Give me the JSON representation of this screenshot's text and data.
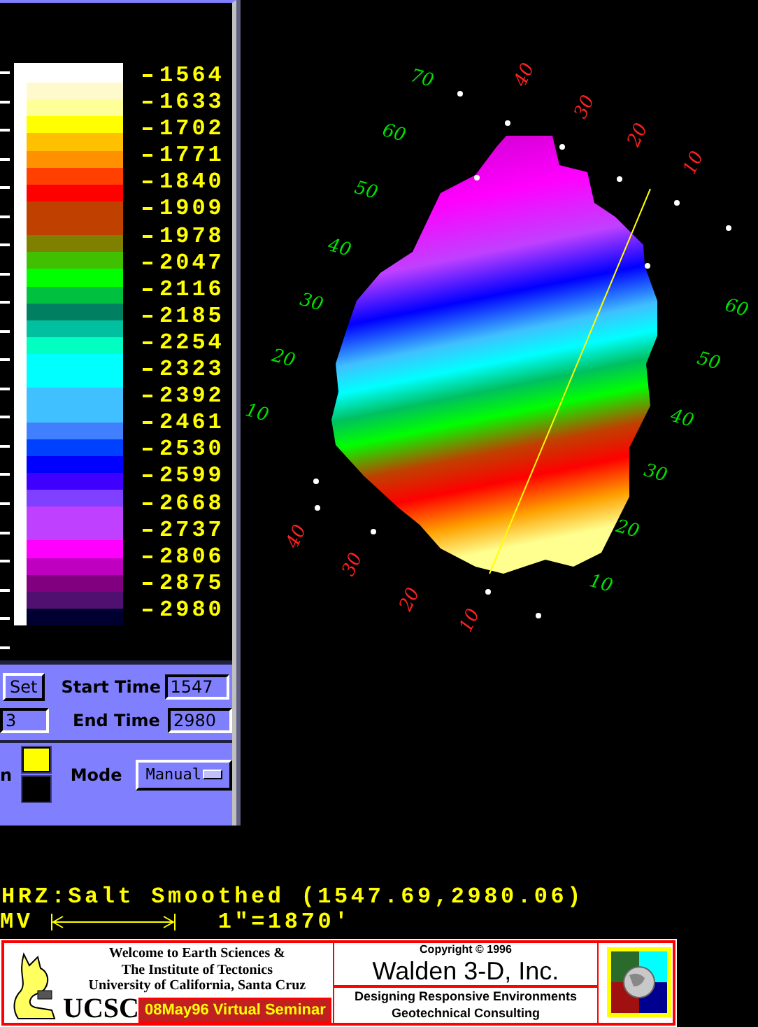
{
  "legend": {
    "bands": [
      {
        "color": "#fffacd"
      },
      {
        "color": "#ffff99"
      },
      {
        "color": "#ffff00"
      },
      {
        "color": "#ffc000"
      },
      {
        "color": "#ff9000"
      },
      {
        "color": "#ff4000"
      },
      {
        "color": "#ff0000"
      },
      {
        "color": "#c04000"
      },
      {
        "color": "#c04000"
      },
      {
        "color": "#808000"
      },
      {
        "color": "#40c000"
      },
      {
        "color": "#00ff00"
      },
      {
        "color": "#00c040"
      },
      {
        "color": "#008060"
      },
      {
        "color": "#00c0a0"
      },
      {
        "color": "#00ffc0"
      },
      {
        "color": "#00ffff"
      },
      {
        "color": "#00ffff"
      },
      {
        "color": "#40c0ff"
      },
      {
        "color": "#40c0ff"
      },
      {
        "color": "#4080ff"
      },
      {
        "color": "#0040ff"
      },
      {
        "color": "#0000ff"
      },
      {
        "color": "#4000ff"
      },
      {
        "color": "#8040ff"
      },
      {
        "color": "#c040ff"
      },
      {
        "color": "#c040ff"
      },
      {
        "color": "#ff00ff"
      },
      {
        "color": "#c000c0"
      },
      {
        "color": "#800080"
      },
      {
        "color": "#501070"
      },
      {
        "color": "#000030"
      }
    ],
    "labels": [
      "1564",
      "1633",
      "1702",
      "1771",
      "1840",
      "1909",
      "1978",
      "2047",
      "2116",
      "2185",
      "2254",
      "2323",
      "2392",
      "2461",
      "2530",
      "2599",
      "2668",
      "2737",
      "2806",
      "2875",
      "2980"
    ]
  },
  "controls": {
    "set_button": "Set",
    "start_time": {
      "label": "Start Time",
      "value": "1547"
    },
    "cut_field_value": "3",
    "end_time": {
      "label": "End Time",
      "value": "2980"
    },
    "cut_label": "n",
    "swatches": [
      {
        "color": "#ffff00"
      },
      {
        "color": "#000000"
      }
    ],
    "mode": {
      "label": "Mode",
      "value": "Manual"
    }
  },
  "map": {
    "grid_labels": [
      {
        "text": "70",
        "kind": "green"
      },
      {
        "text": "60",
        "kind": "green"
      },
      {
        "text": "50",
        "kind": "green"
      },
      {
        "text": "40",
        "kind": "green"
      },
      {
        "text": "30",
        "kind": "green"
      },
      {
        "text": "20",
        "kind": "green"
      },
      {
        "text": "10",
        "kind": "green"
      },
      {
        "text": "40",
        "kind": "red"
      },
      {
        "text": "30",
        "kind": "red"
      },
      {
        "text": "20",
        "kind": "red"
      },
      {
        "text": "10",
        "kind": "red"
      },
      {
        "text": "60",
        "kind": "green"
      },
      {
        "text": "50",
        "kind": "green"
      },
      {
        "text": "40",
        "kind": "green"
      },
      {
        "text": "30",
        "kind": "green"
      },
      {
        "text": "20",
        "kind": "green"
      },
      {
        "text": "10",
        "kind": "green"
      },
      {
        "text": "40",
        "kind": "red"
      },
      {
        "text": "30",
        "kind": "red"
      },
      {
        "text": "20",
        "kind": "red"
      },
      {
        "text": "10",
        "kind": "red"
      }
    ]
  },
  "caption": "HRZ:Salt Smoothed (1547.69,2980.06)",
  "scale": {
    "label": "MV",
    "text": "1\"=1870'"
  },
  "banner": {
    "welcome_lines": [
      "Welcome to Earth Sciences &",
      "The Institute of Tectonics",
      "University of California, Santa Cruz"
    ],
    "ucsc": "UCSC",
    "seminar": "08May96 Virtual Seminar",
    "copyright": "Copyright © 1996",
    "company": "Walden 3-D, Inc.",
    "tagline": "Designing Responsive Environments",
    "service": "Geotechnical Consulting"
  }
}
